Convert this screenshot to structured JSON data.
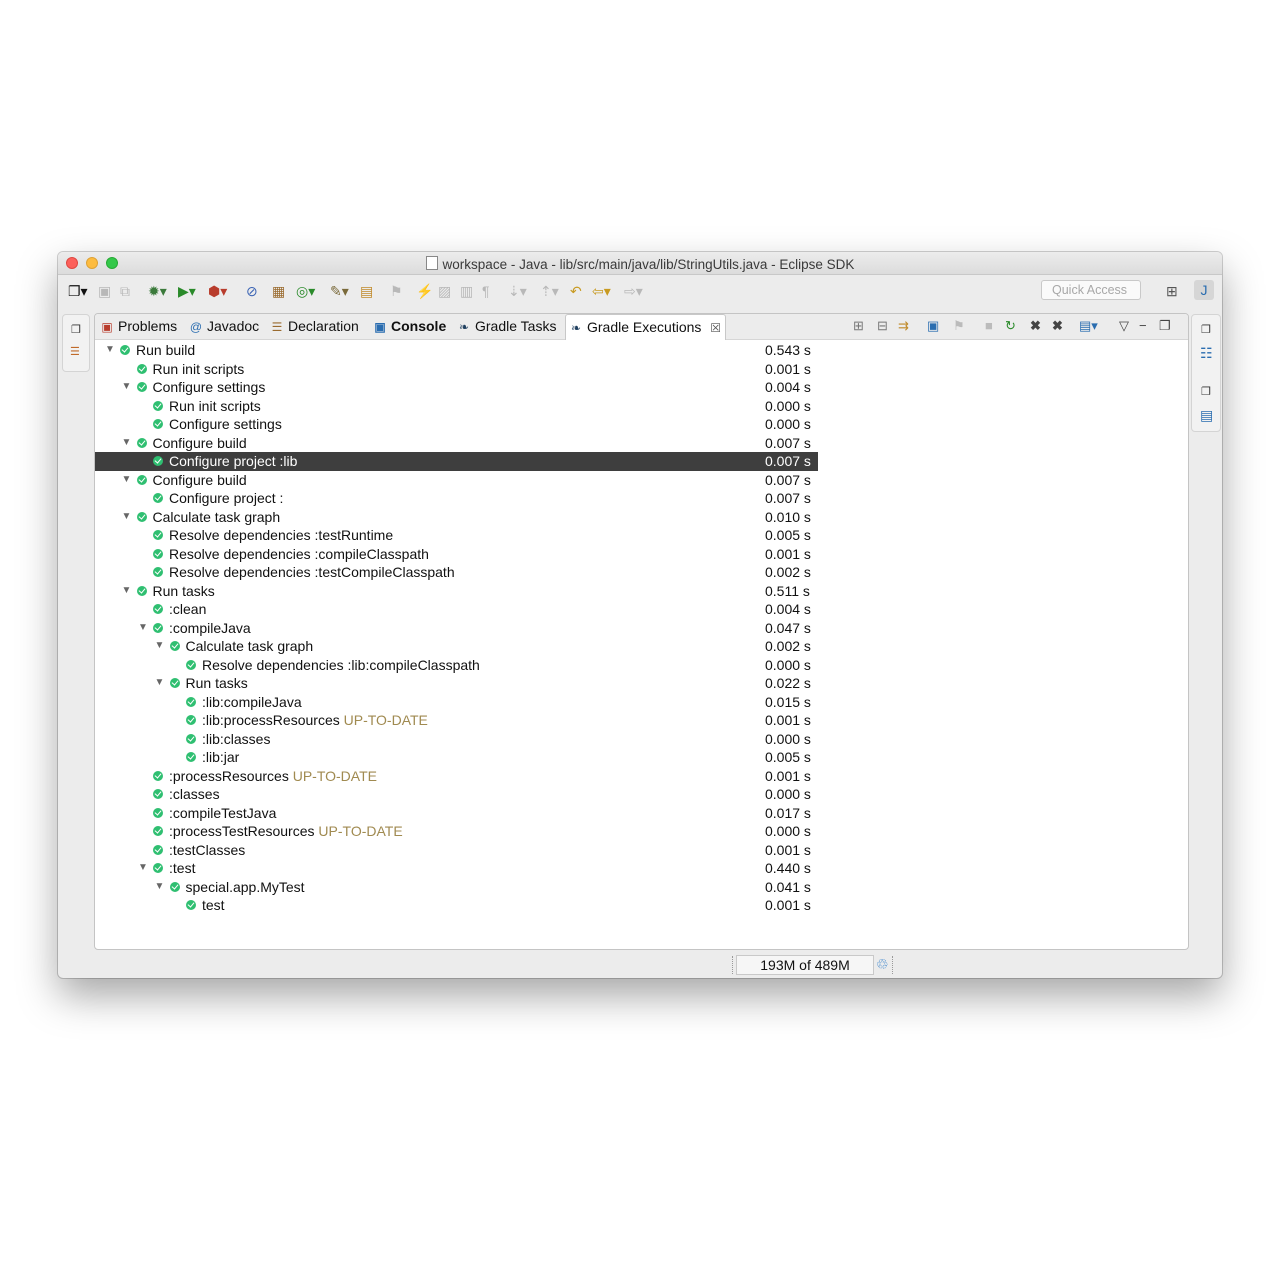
{
  "window": {
    "title": "workspace - Java - lib/src/main/java/lib/StringUtils.java - Eclipse SDK"
  },
  "toolbar": {
    "quick_access_placeholder": "Quick Access"
  },
  "tabs": [
    {
      "label": "Problems",
      "icon": "problems-icon"
    },
    {
      "label": "Javadoc",
      "icon": "javadoc-icon"
    },
    {
      "label": "Declaration",
      "icon": "declaration-icon"
    },
    {
      "label": "Console",
      "icon": "console-icon"
    },
    {
      "label": "Gradle Tasks",
      "icon": "gradle-icon"
    },
    {
      "label": "Gradle Executions",
      "icon": "gradle-icon",
      "active": true
    }
  ],
  "tree": [
    {
      "label": "Run build",
      "duration": "0.543 s",
      "level": 0,
      "expanded": true
    },
    {
      "label": "Run init scripts",
      "duration": "0.001 s",
      "level": 1
    },
    {
      "label": "Configure settings",
      "duration": "0.004 s",
      "level": 1,
      "expanded": true
    },
    {
      "label": "Run init scripts",
      "duration": "0.000 s",
      "level": 2
    },
    {
      "label": "Configure settings",
      "duration": "0.000 s",
      "level": 2
    },
    {
      "label": "Configure build",
      "duration": "0.007 s",
      "level": 1,
      "expanded": true
    },
    {
      "label": "Configure project :lib",
      "duration": "0.007 s",
      "level": 2,
      "selected": true
    },
    {
      "label": "Configure build",
      "duration": "0.007 s",
      "level": 1,
      "expanded": true
    },
    {
      "label": "Configure project :",
      "duration": "0.007 s",
      "level": 2
    },
    {
      "label": "Calculate task graph",
      "duration": "0.010 s",
      "level": 1,
      "expanded": true
    },
    {
      "label": "Resolve dependencies :testRuntime",
      "duration": "0.005 s",
      "level": 2
    },
    {
      "label": "Resolve dependencies :compileClasspath",
      "duration": "0.001 s",
      "level": 2
    },
    {
      "label": "Resolve dependencies :testCompileClasspath",
      "duration": "0.002 s",
      "level": 2
    },
    {
      "label": "Run tasks",
      "duration": "0.511 s",
      "level": 1,
      "expanded": true
    },
    {
      "label": ":clean",
      "duration": "0.004 s",
      "level": 2
    },
    {
      "label": ":compileJava",
      "duration": "0.047 s",
      "level": 2,
      "expanded": true
    },
    {
      "label": "Calculate task graph",
      "duration": "0.002 s",
      "level": 3,
      "expanded": true
    },
    {
      "label": "Resolve dependencies :lib:compileClasspath",
      "duration": "0.000 s",
      "level": 4
    },
    {
      "label": "Run tasks",
      "duration": "0.022 s",
      "level": 3,
      "expanded": true
    },
    {
      "label": ":lib:compileJava",
      "duration": "0.015 s",
      "level": 4
    },
    {
      "label": ":lib:processResources",
      "status": "UP-TO-DATE",
      "duration": "0.001 s",
      "level": 4
    },
    {
      "label": ":lib:classes",
      "duration": "0.000 s",
      "level": 4
    },
    {
      "label": ":lib:jar",
      "duration": "0.005 s",
      "level": 4
    },
    {
      "label": ":processResources",
      "status": "UP-TO-DATE",
      "duration": "0.001 s",
      "level": 2
    },
    {
      "label": ":classes",
      "duration": "0.000 s",
      "level": 2
    },
    {
      "label": ":compileTestJava",
      "duration": "0.017 s",
      "level": 2
    },
    {
      "label": ":processTestResources",
      "status": "UP-TO-DATE",
      "duration": "0.000 s",
      "level": 2
    },
    {
      "label": ":testClasses",
      "duration": "0.001 s",
      "level": 2
    },
    {
      "label": ":test",
      "duration": "0.440 s",
      "level": 2,
      "expanded": true
    },
    {
      "label": "special.app.MyTest",
      "duration": "0.041 s",
      "level": 3,
      "expanded": true
    },
    {
      "label": "test",
      "duration": "0.001 s",
      "level": 4
    }
  ],
  "status": {
    "memory": "193M of 489M"
  },
  "colors": {
    "success": "#2fbf71",
    "up_to_date": "#a08a50",
    "selection": "#3e3e3e"
  }
}
